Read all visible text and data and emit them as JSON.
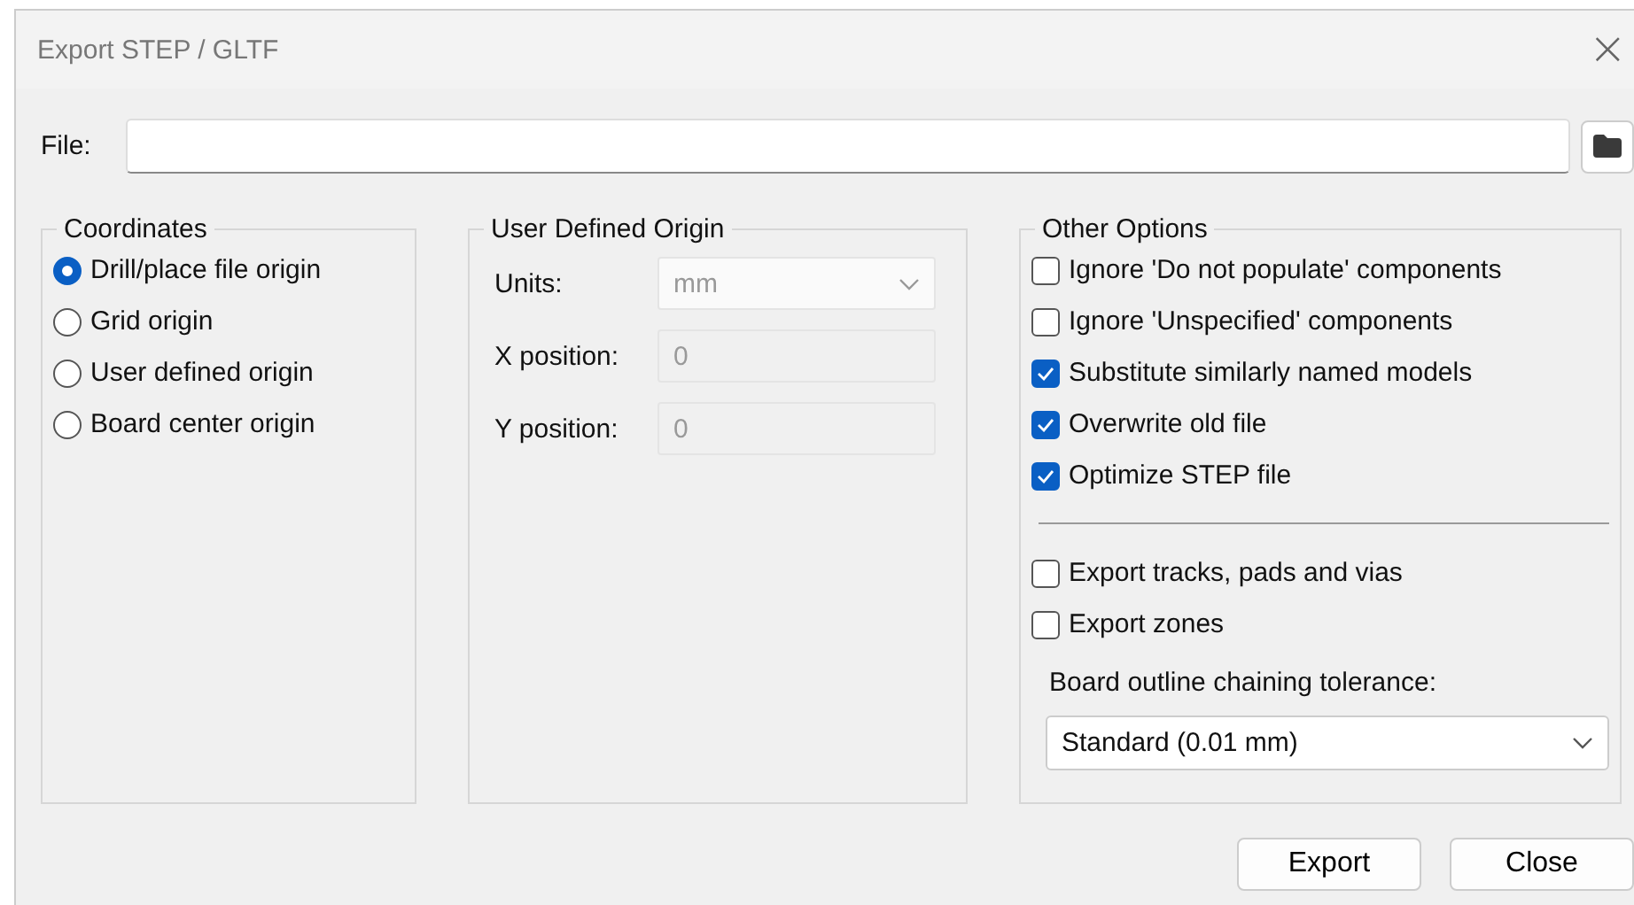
{
  "window": {
    "title": "Export STEP / GLTF",
    "close": "×"
  },
  "file": {
    "label": "File:"
  },
  "coordinates": {
    "title": "Coordinates",
    "options": [
      {
        "label": "Drill/place file origin",
        "selected": true
      },
      {
        "label": "Grid origin",
        "selected": false
      },
      {
        "label": "User defined origin",
        "selected": false
      },
      {
        "label": "Board center origin",
        "selected": false
      }
    ]
  },
  "user_defined_origin": {
    "title": "User Defined Origin",
    "fields": [
      {
        "kind": "select",
        "label": "Units:",
        "value": "mm",
        "disabled": true
      },
      {
        "kind": "input",
        "label": "X position:",
        "value": "0",
        "disabled": true
      },
      {
        "kind": "input",
        "label": "Y position:",
        "value": "0",
        "disabled": true
      }
    ]
  },
  "other_options": {
    "title": "Other Options",
    "groups": [
      [
        {
          "label": "Ignore 'Do not populate' components",
          "checked": false
        },
        {
          "label": "Ignore 'Unspecified' components",
          "checked": false
        },
        {
          "label": "Substitute similarly named models",
          "checked": true
        },
        {
          "label": "Overwrite old file",
          "checked": true
        },
        {
          "label": "Optimize STEP file",
          "checked": true
        }
      ],
      [
        {
          "label": "Export tracks, pads and vias",
          "checked": false
        },
        {
          "label": "Export zones",
          "checked": false
        }
      ]
    ],
    "tolerance": {
      "label": "Board outline chaining tolerance:",
      "value": "Standard (0.01 mm)"
    }
  },
  "buttons": [
    "Export",
    "Close"
  ]
}
